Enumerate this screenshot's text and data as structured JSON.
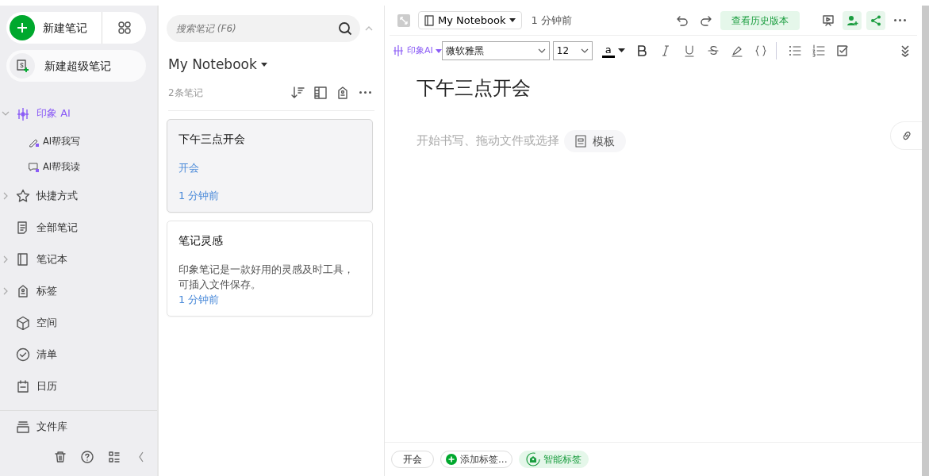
{
  "sidebar": {
    "new_note": "新建笔记",
    "new_super_note": "新建超级笔记",
    "items": [
      {
        "label": "印象 AI",
        "kind": "ai",
        "expanded": true,
        "children": [
          {
            "label": "AI帮我写"
          },
          {
            "label": "AI帮我读"
          }
        ]
      },
      {
        "label": "快捷方式",
        "kind": "nav",
        "expanded": false
      },
      {
        "label": "全部笔记",
        "kind": "nav"
      },
      {
        "label": "笔记本",
        "kind": "nav",
        "expanded": false
      },
      {
        "label": "标签",
        "kind": "nav",
        "expanded": false
      },
      {
        "label": "空间",
        "kind": "nav"
      },
      {
        "label": "清单",
        "kind": "nav"
      },
      {
        "label": "日历",
        "kind": "nav"
      }
    ],
    "bottom_item": {
      "label": "文件库"
    }
  },
  "note_list": {
    "search": {
      "placeholder": "搜索笔记 (F6)"
    },
    "notebook": "My Notebook",
    "count": "2条笔记",
    "notes": [
      {
        "title": "下午三点开会",
        "tag": "开会",
        "time": "1 分钟前",
        "selected": true
      },
      {
        "title": "笔记灵感",
        "snippet": "印象笔记是一款好用的灵感及时工具，可插入文件保存。",
        "time": "1 分钟前",
        "selected": false
      }
    ]
  },
  "editor": {
    "notebook": "My Notebook",
    "updated": "1 分钟前",
    "history_button": "查看历史版本",
    "toolbar": {
      "ai": "印象AI",
      "font": "微软雅黑",
      "size": "12",
      "text_color_letter": "a"
    },
    "title": "下午三点开会",
    "placeholder": "开始书写、拖动文件或选择",
    "template": "模板",
    "tags": [
      {
        "label": "开会",
        "kind": "tag"
      },
      {
        "label": "添加标签...",
        "kind": "add"
      },
      {
        "label": "智能标签",
        "kind": "smart"
      }
    ]
  }
}
